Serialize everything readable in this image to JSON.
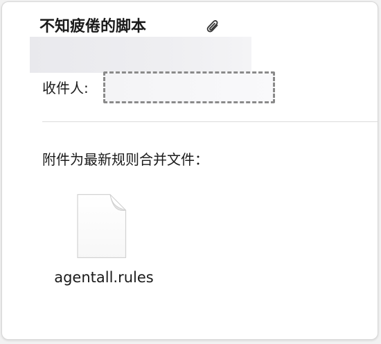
{
  "message": {
    "subject": "不知疲倦的脚本",
    "has_attachment_icon": "paperclip-icon",
    "recipient_label": "收件人:",
    "body_text": "附件为最新规则合并文件：",
    "attachments": [
      {
        "name": "agentall.rules",
        "icon": "document-icon"
      }
    ]
  },
  "colors": {
    "background": "#ffffff",
    "text": "#1a1a1a",
    "dashed_border": "#8a8a8a",
    "divider": "#dcdcdc"
  }
}
